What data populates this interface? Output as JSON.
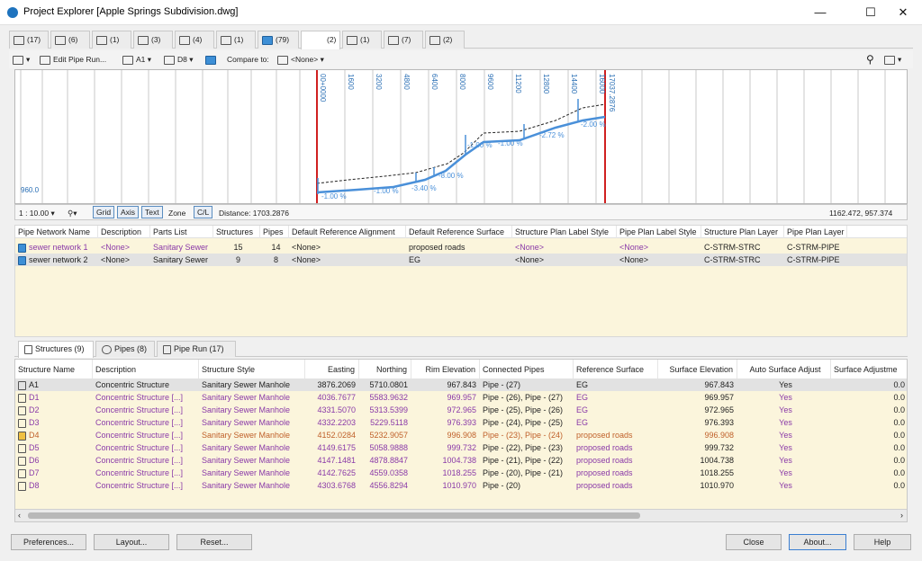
{
  "window": {
    "title": "Project Explorer [Apple Springs Subdivision.dwg]",
    "minimize": "—",
    "maximize": "☐",
    "close": "✕"
  },
  "tabs": [
    {
      "icon": "alignment-icon",
      "count": "(17)"
    },
    {
      "icon": "bridge-icon",
      "count": "(6)"
    },
    {
      "icon": "corridor-icon",
      "count": "(1)"
    },
    {
      "icon": "sample-lines-icon",
      "count": "(3)"
    },
    {
      "icon": "parcel-icon",
      "count": "(4)"
    },
    {
      "icon": "feature-line-icon",
      "count": "(1)"
    },
    {
      "icon": "pipe-network-icon",
      "count": "(79)"
    },
    {
      "icon": "blank-tab-icon",
      "count": "(2)"
    },
    {
      "icon": "grading-icon",
      "count": "(1)"
    },
    {
      "icon": "pressure-network-icon",
      "count": "(7)"
    },
    {
      "icon": "table-icon",
      "count": "(2)"
    }
  ],
  "toolbar": {
    "edit_pipe_run": "Edit Pipe Run...",
    "a1": "A1",
    "d8": "D8",
    "compare_to": "Compare to:",
    "compare_value": "<None>"
  },
  "profile": {
    "stations": [
      "00+0000",
      "1600",
      "3200",
      "4800",
      "6400",
      "8000",
      "9600",
      "11200",
      "12800",
      "14400",
      "16000",
      "17037.2876"
    ],
    "elev_label": "960.0",
    "slopes": [
      "-1.00 %",
      "-1.00 %",
      "-3.40 %",
      "-8.00 %",
      "-1.00 %",
      "-1.00 %",
      "-2.72 %",
      "-2.00 %"
    ]
  },
  "profile_bar": {
    "scale": "1 : 10.00",
    "grid": "Grid",
    "axis": "Axis",
    "text": "Text",
    "zone": "Zone",
    "cl": "C/L",
    "distance": "Distance: 1703.2876",
    "coords": "1162.472, 957.374"
  },
  "network_table": {
    "headers": [
      "Pipe Network Name",
      "Description",
      "Parts List",
      "Structures",
      "Pipes",
      "Default Reference Alignment",
      "Default Reference Surface",
      "Structure Plan Label Style",
      "Pipe Plan Label Style",
      "Structure Plan Layer",
      "Pipe Plan Layer"
    ],
    "rows": [
      [
        "sewer network 1",
        "<None>",
        "Sanitary Sewer",
        "15",
        "14",
        "<None>",
        "proposed roads",
        "<None>",
        "<None>",
        "C-STRM-STRC",
        "C-STRM-PIPE"
      ],
      [
        "sewer network 2",
        "<None>",
        "Sanitary Sewer",
        "9",
        "8",
        "<None>",
        "EG",
        "<None>",
        "<None>",
        "C-STRM-STRC",
        "C-STRM-PIPE"
      ]
    ]
  },
  "bottom_tabs": [
    "Structures (9)",
    "Pipes (8)",
    "Pipe Run (17)"
  ],
  "structures_table": {
    "headers": [
      "Structure Name",
      "Description",
      "Structure Style",
      "Easting",
      "Northing",
      "Rim Elevation",
      "Connected Pipes",
      "Reference Surface",
      "Surface Elevation",
      "Auto Surface Adjust",
      "Surface Adjustme"
    ],
    "rows": [
      [
        "A1",
        "Concentric Structure",
        "Sanitary Sewer Manhole",
        "3876.2069",
        "5710.0801",
        "967.843",
        "Pipe - (27)",
        "EG",
        "967.843",
        "Yes",
        "0.0"
      ],
      [
        "D1",
        "Concentric Structure [...]",
        "Sanitary Sewer Manhole",
        "4036.7677",
        "5583.9632",
        "969.957",
        "Pipe - (26), Pipe - (27)",
        "EG",
        "969.957",
        "Yes",
        "0.0"
      ],
      [
        "D2",
        "Concentric Structure [...]",
        "Sanitary Sewer Manhole",
        "4331.5070",
        "5313.5399",
        "972.965",
        "Pipe - (25), Pipe - (26)",
        "EG",
        "972.965",
        "Yes",
        "0.0"
      ],
      [
        "D3",
        "Concentric Structure [...]",
        "Sanitary Sewer Manhole",
        "4332.2203",
        "5229.5118",
        "976.393",
        "Pipe - (24), Pipe - (25)",
        "EG",
        "976.393",
        "Yes",
        "0.0"
      ],
      [
        "D4",
        "Concentric Structure [...]",
        "Sanitary Sewer Manhole",
        "4152.0284",
        "5232.9057",
        "996.908",
        "Pipe - (23), Pipe - (24)",
        "proposed roads",
        "996.908",
        "Yes",
        "0.0"
      ],
      [
        "D5",
        "Concentric Structure [...]",
        "Sanitary Sewer Manhole",
        "4149.6175",
        "5058.9888",
        "999.732",
        "Pipe - (22), Pipe - (23)",
        "proposed roads",
        "999.732",
        "Yes",
        "0.0"
      ],
      [
        "D6",
        "Concentric Structure [...]",
        "Sanitary Sewer Manhole",
        "4147.1481",
        "4878.8847",
        "1004.738",
        "Pipe - (21), Pipe - (22)",
        "proposed roads",
        "1004.738",
        "Yes",
        "0.0"
      ],
      [
        "D7",
        "Concentric Structure [...]",
        "Sanitary Sewer Manhole",
        "4142.7625",
        "4559.0358",
        "1018.255",
        "Pipe - (20), Pipe - (21)",
        "proposed roads",
        "1018.255",
        "Yes",
        "0.0"
      ],
      [
        "D8",
        "Concentric Structure [...]",
        "Sanitary Sewer Manhole",
        "4303.6768",
        "4556.8294",
        "1010.970",
        "Pipe - (20)",
        "proposed roads",
        "1010.970",
        "Yes",
        "0.0"
      ]
    ]
  },
  "footer": {
    "preferences": "Preferences...",
    "layout": "Layout...",
    "reset": "Reset...",
    "close": "Close",
    "about": "About...",
    "help": "Help"
  }
}
